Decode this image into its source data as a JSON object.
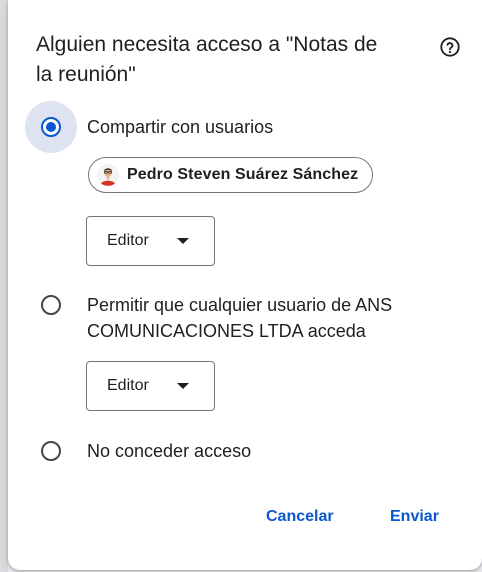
{
  "dialog": {
    "title": "Alguien necesita acceso a \"Notas de la reunión\"",
    "help_icon": "help-circle-icon",
    "accent_color": "#0b57d0",
    "options": [
      {
        "label": "Compartir con usuarios",
        "selected": true,
        "chip": {
          "avatar_icon": "user-avatar-icon",
          "label": "Pedro Steven Suárez Sánchez"
        },
        "role": "Editor"
      },
      {
        "label": "Permitir que cualquier usuario de ANS COMUNICACIONES LTDA acceda",
        "selected": false,
        "role": "Editor"
      },
      {
        "label": "No conceder acceso",
        "selected": false
      }
    ],
    "buttons": {
      "cancel": "Cancelar",
      "send": "Enviar"
    }
  }
}
